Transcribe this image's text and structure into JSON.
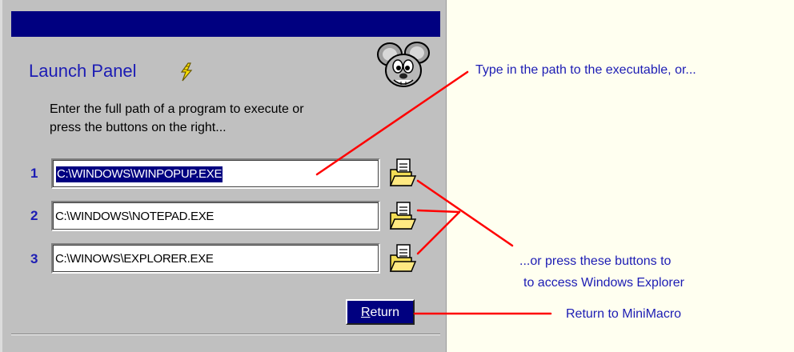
{
  "panel": {
    "title": "Launch Panel",
    "instructions": [
      "Enter the full path of a program to execute or",
      "press the  buttons on the right..."
    ],
    "rows": [
      {
        "number": "1",
        "path": "C:\\WINDOWS\\WINPOPUP.EXE",
        "selected": true
      },
      {
        "number": "2",
        "path": "C:\\WINDOWS\\NOTEPAD.EXE",
        "selected": false
      },
      {
        "number": "3",
        "path": "C:\\WINOWS\\EXPLORER.EXE",
        "selected": false
      }
    ],
    "return_label_first": "R",
    "return_label_rest": "eturn",
    "icons": {
      "title_icon": "lightning-bolt-icon",
      "mascot": "mouse-mascot-icon",
      "browse": "open-folder-icon"
    }
  },
  "annotations": {
    "type_path": "Type in the path to the executable, or...",
    "press_buttons_line1": "...or press these buttons to",
    "press_buttons_line2": "to access Windows Explorer",
    "return_to": "Return to MiniMacro"
  },
  "colors": {
    "panel_bg": "#c0c0c0",
    "titlebar": "#000080",
    "accent_text": "#1c1cb4",
    "callout_line": "#ff0000",
    "page_bg": "#fffff0"
  }
}
